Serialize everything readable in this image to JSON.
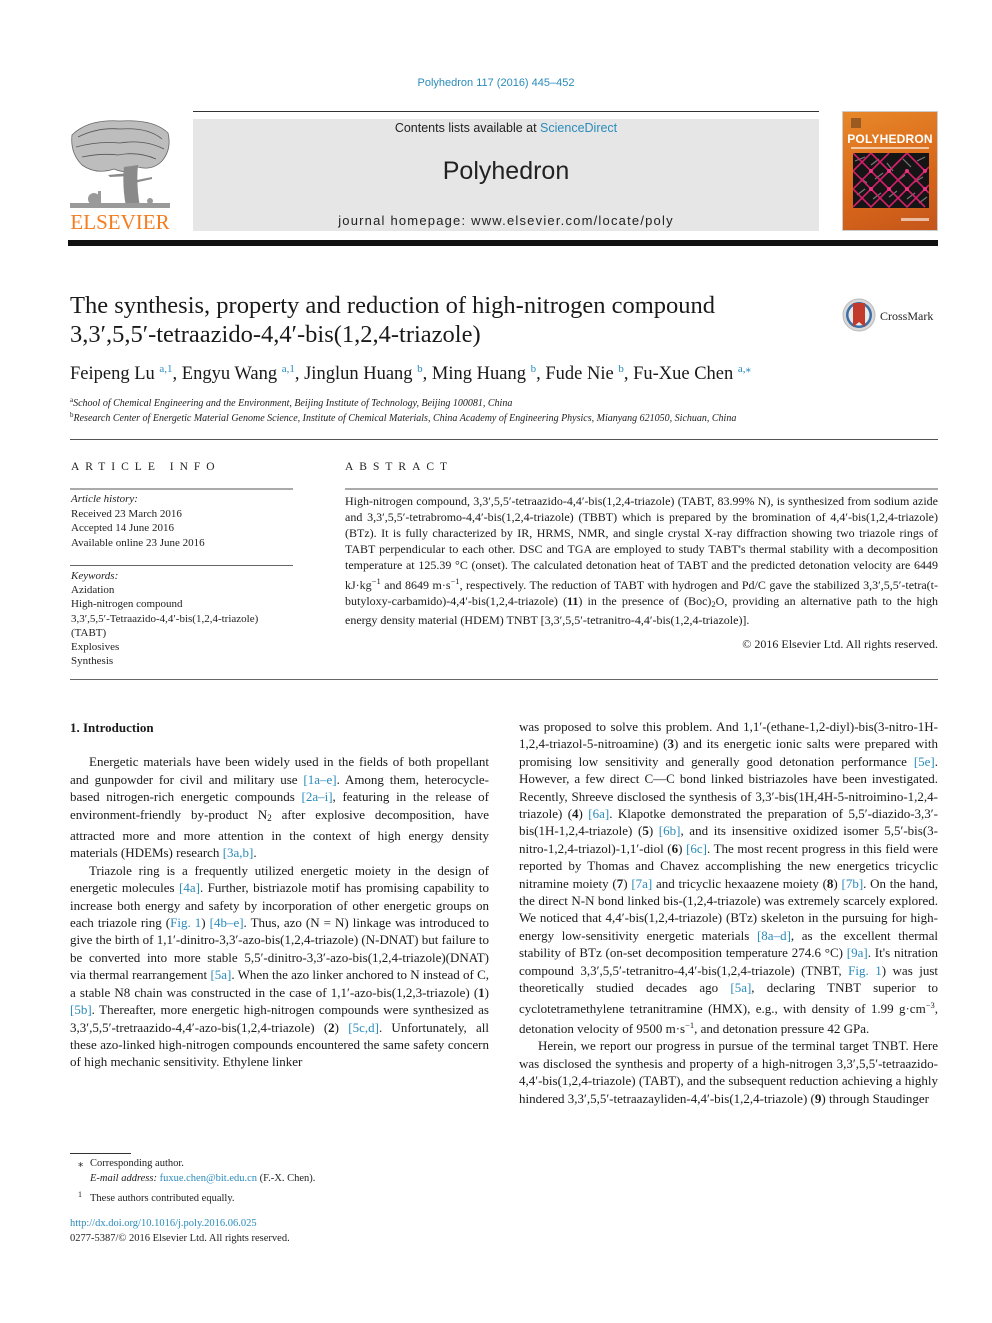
{
  "header": {
    "citation": "Polyhedron 117 (2016) 445–452",
    "contents_prefix": "Contents lists available at ",
    "contents_link": "ScienceDirect",
    "journal_name": "Polyhedron",
    "homepage_prefix": "journal homepage: ",
    "homepage_url": "www.elsevier.com/locate/poly",
    "publisher_logo": "ELSEVIER",
    "cover_title": "POLYHEDRON",
    "brand_color": "#f47d20",
    "link_color": "#2a8bbb"
  },
  "article": {
    "title_line1": "The synthesis, property and reduction of high-nitrogen compound",
    "title_line2": "3,3′,5,5′-tetraazido-4,4′-bis(1,2,4-triazole)",
    "crossmark_label": "CrossMark",
    "authors": [
      {
        "name": "Feipeng Lu",
        "sup": "a,1",
        "sep": ", "
      },
      {
        "name": "Engyu Wang",
        "sup": "a,1",
        "sep": ", "
      },
      {
        "name": "Jinglun Huang",
        "sup": "b",
        "sep": ", "
      },
      {
        "name": "Ming Huang",
        "sup": "b",
        "sep": ", "
      },
      {
        "name": "Fude Nie",
        "sup": "b",
        "sep": ", "
      },
      {
        "name": "Fu-Xue Chen",
        "sup": "a,⁎",
        "sep": ""
      }
    ],
    "affiliations": [
      {
        "mark": "a",
        "text": "School of Chemical Engineering and the Environment, Beijing Institute of Technology, Beijing 100081, China"
      },
      {
        "mark": "b",
        "text": "Research Center of Energetic Material Genome Science, Institute of Chemical Materials, China Academy of Engineering Physics, Mianyang 621050, Sichuan, China"
      }
    ]
  },
  "article_info": {
    "heading": "ARTICLE INFO",
    "history_label": "Article history:",
    "received": "Received 23 March 2016",
    "accepted": "Accepted 14 June 2016",
    "online": "Available online 23 June 2016",
    "keywords_label": "Keywords:",
    "keywords": [
      "Azidation",
      "High-nitrogen compound",
      "3,3′,5,5′-Tetraazido-4,4′-bis(1,2,4-triazole)",
      "(TABT)",
      "Explosives",
      "Synthesis"
    ]
  },
  "abstract": {
    "heading": "ABSTRACT",
    "s1": "High-nitrogen compound, 3,3′,5,5′-tetraazido-4,4′-bis(1,2,4-triazole) (TABT, 83.99% N), is synthesized from sodium azide and 3,3′,5,5′-tetrabromo-4,4′-bis(1,2,4-triazole) (TBBT) which is prepared by the bromination of 4,4′-bis(1,2,4-triazole) (BTz). It is fully characterized by IR, HRMS, NMR, and single crystal X-ray diffraction showing two triazole rings of TABT perpendicular to each other. DSC and TGA are employed to study TABT's thermal stability with a decomposition temperature at 125.39 °C (onset). The calculated detonation heat of TABT and the predicted detonation velocity are 6449 kJ·kg",
    "exp1": "−1",
    "s2": " and 8649 m·s",
    "exp2": "−1",
    "s3": ", respectively. The reduction of TABT with hydrogen and Pd/C gave the stabilized 3,3′,5,5′-tetra(t-butyloxy-carbamido)-4,4′-bis(1,2,4-triazole) (",
    "bold1": "11",
    "s4": ") in the presence of (Boc)",
    "sub1": "2",
    "s5": "O, providing an alternative path to the high energy density material (HDEM) TNBT [3,3′,5,5′-tetranitro-4,4′-bis(1,2,4-triazole)].",
    "copyright": "© 2016 Elsevier Ltd. All rights reserved."
  },
  "body": {
    "section_heading": "1. Introduction",
    "p1": {
      "t1": "Energetic materials have been widely used in the fields of both propellant and gunpowder for civil and military use ",
      "r1": "[1a–e]",
      "t2": ". Among them, heterocycle-based nitrogen-rich energetic compounds ",
      "r2": "[2a–i]",
      "t3": ", featuring in the release of environment-friendly by-product N",
      "sub": "2",
      "t4": " after explosive decomposition, have attracted more and more attention in the context of high energy density materials (HDEMs) research ",
      "r3": "[3a,b]",
      "t5": "."
    },
    "p2": {
      "t1": "Triazole ring is a frequently utilized energetic moiety in the design of energetic molecules ",
      "r1": "[4a]",
      "t2": ". Further, bistriazole motif has promising capability to increase both energy and safety by incorporation of other energetic groups on each triazole ring (",
      "r2": "Fig. 1",
      "t3": ") ",
      "r3": "[4b–e]",
      "t4": ". Thus, azo (N = N) linkage was introduced to give the birth of 1,1′-dinitro-3,3′-azo-bis(1,2,4-triazole) (N-DNAT) but failure to be converted into more stable 5,5′-dinitro-3,3′-azo-bis(1,2,4-triazole)(DNAT) via thermal rearrangement ",
      "r4": "[5a]",
      "t5": ". When the azo linker anchored to N instead of C, a stable N8 chain was constructed in the case of 1,1′-azo-bis(1,2,3-triazole) (",
      "b1": "1",
      "t6": ") ",
      "r5": "[5b]",
      "t7": ". Thereafter, more energetic high-nitrogen compounds were synthesized as 3,3′,5,5′-tretraazido-4,4′-azo-bis(1,2,4-triazole) (",
      "b2": "2",
      "t8": ") ",
      "r6": "[5c,d]",
      "t9": ". Unfortunately, all these azo-linked high-nitrogen compounds encountered the same safety concern of high mechanic sensitivity. Ethylene linker"
    },
    "p3": {
      "t1": "was proposed to solve this problem. And 1,1′-(ethane-1,2-diyl)-bis(3-nitro-1H-1,2,4-triazol-5-nitroamine) (",
      "b1": "3",
      "t2": ") and its energetic ionic salts were prepared with promising low sensitivity and generally good detonation performance ",
      "r1": "[5e]",
      "t3": ". However, a few direct C—C bond linked bistriazoles have been investigated. Recently, Shreeve disclosed the synthesis of 3,3′-bis(1H,4H-5-nitroimino-1,2,4-triazole) (",
      "b2": "4",
      "t4": ") ",
      "r2": "[6a]",
      "t5": ". Klapotke demonstrated the preparation of 5,5′-diazido-3,3′-bis(1H-1,2,4-triazole) (",
      "b3": "5",
      "t6": ") ",
      "r3": "[6b]",
      "t7": ", and its insensitive oxidized isomer 5,5′-bis(3-nitro-1,2,4-triazol)-1,1′-diol (",
      "b4": "6",
      "t8": ") ",
      "r4": "[6c]",
      "t9": ". The most recent progress in this field were reported by Thomas and Chavez accomplishing the new energetics tricyclic nitramine moiety (",
      "b5": "7",
      "t10": ") ",
      "r5": "[7a]",
      "t11": " and tricyclic hexaazene moiety (",
      "b6": "8",
      "t12": ") ",
      "r6": "[7b]",
      "t13": ". On the hand, the direct N-N bond linked bis-(1,2,4-triazole) was extremely scarcely explored. We noticed that 4,4′-bis(1,2,4-triazole) (BTz) skeleton in the pursuing for high-energy low-sensitivity energetic materials ",
      "r7": "[8a–d]",
      "t14": ", as the excellent thermal stability of BTz (on-set decomposition temperature 274.6 °C) ",
      "r8": "[9a]",
      "t15": ". It's nitration compound 3,3′,5,5′-tetranitro-4,4′-bis(1,2,4-triazole) (TNBT, ",
      "r9": "Fig. 1",
      "t16": ") was just theoretically studied decades ago ",
      "r10": "[5a]",
      "t17": ", declaring TNBT superior to cyclotetramethylene tetranitramine (HMX), e.g., with density of 1.99 g·cm",
      "e1": "−3",
      "t18": ", detonation velocity of 9500 m·s",
      "e2": "−1",
      "t19": ", and detonation pressure 42 GPa."
    },
    "p4": {
      "t1": "Herein, we report our progress in pursue of the terminal target TNBT. Here was disclosed the synthesis and property of a high-nitrogen 3,3′,5,5′-tetraazido-4,4′-bis(1,2,4-triazole) (TABT), and the subsequent reduction achieving a highly hindered 3,3′,5,5′-tetraazayliden-4,4′-bis(1,2,4-triazole) (",
      "b1": "9",
      "t2": ") through Staudinger"
    }
  },
  "footnotes": {
    "corr_mark": "⁎",
    "corr_text": "Corresponding author.",
    "email_label": "E-mail address: ",
    "email": "fuxue.chen@bit.edu.cn",
    "email_suffix": " (F.-X. Chen).",
    "eq_mark": "1",
    "eq_text": "These authors contributed equally.",
    "doi": "http://dx.doi.org/10.1016/j.poly.2016.06.025",
    "issn": "0277-5387/© 2016 Elsevier Ltd. All rights reserved."
  }
}
